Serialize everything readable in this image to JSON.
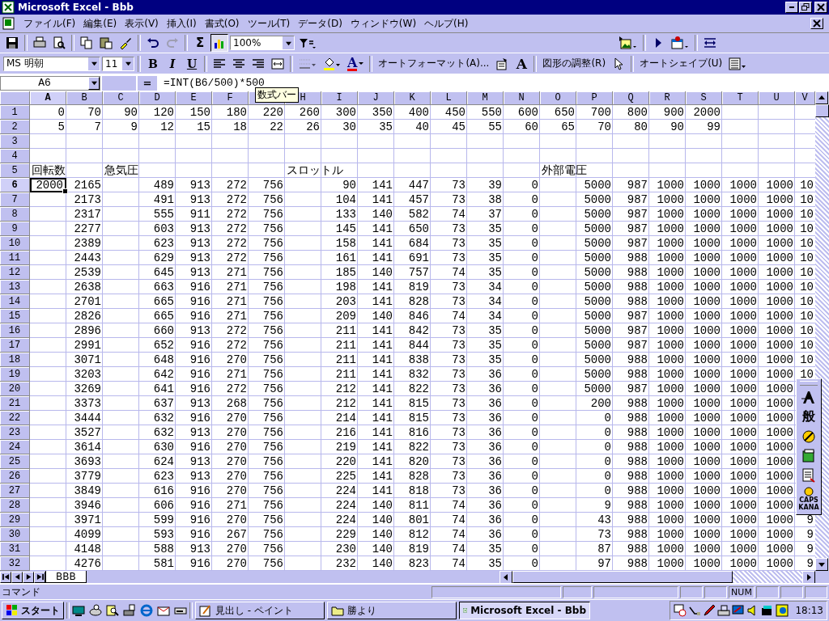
{
  "window": {
    "title": "Microsoft Excel - Bbb"
  },
  "menu": [
    "ファイル(F)",
    "編集(E)",
    "表示(V)",
    "挿入(I)",
    "書式(O)",
    "ツール(T)",
    "データ(D)",
    "ウィンドウ(W)",
    "ヘルプ(H)"
  ],
  "standard_toolbar": {
    "sum": "Σ",
    "zoom": "100%"
  },
  "format_toolbar": {
    "font": "MS 明朝",
    "size": "11",
    "bold": "B",
    "italic": "I",
    "underline": "U",
    "font_color": "A",
    "autoformat": "オートフォーマット(A)...",
    "font_size_letter": "A",
    "adjust_shapes": "図形の調整(R)",
    "autoshape": "オートシェイプ(U)"
  },
  "formula_bar": {
    "name_box": "A6",
    "equals": "=",
    "formula": "=INT(B6/500)*500",
    "tooltip": "数式バー"
  },
  "table": {
    "columns": [
      {
        "label": "A",
        "selected": true
      },
      {
        "label": "B",
        "selected": false
      },
      {
        "label": "C",
        "selected": false
      },
      {
        "label": "D",
        "selected": false
      },
      {
        "label": "E",
        "selected": false
      },
      {
        "label": "F",
        "selected": false
      },
      {
        "selected": false
      },
      {
        "label": "H",
        "selected": false
      },
      {
        "label": "I",
        "selected": false
      },
      {
        "label": "J",
        "selected": false
      },
      {
        "label": "K",
        "selected": false
      },
      {
        "label": "L",
        "selected": false
      },
      {
        "label": "M",
        "selected": false
      },
      {
        "label": "N",
        "selected": false
      },
      {
        "label": "O",
        "selected": false
      },
      {
        "label": "P",
        "selected": false
      },
      {
        "label": "Q",
        "selected": false
      },
      {
        "label": "R",
        "selected": false
      },
      {
        "label": "S",
        "selected": false
      },
      {
        "label": "T",
        "selected": false
      },
      {
        "label": "U",
        "selected": false
      },
      {
        "label": "V",
        "selected": false
      }
    ],
    "rows": [
      {
        "header": "1",
        "selected": false,
        "kind": "number",
        "cells": {
          "A": "0",
          "B": "70",
          "C": "90",
          "D": "120",
          "E": "150",
          "F": "180",
          "G": "220",
          "H": "260",
          "I": "300",
          "J": "350",
          "K": "400",
          "L": "450",
          "M": "550",
          "N": "600",
          "O": "650",
          "P": "700",
          "Q": "800",
          "R": "900",
          "S": "2000"
        }
      },
      {
        "header": "2",
        "selected": false,
        "kind": "number",
        "cells": {
          "A": "5",
          "B": "7",
          "C": "9",
          "D": "12",
          "E": "15",
          "F": "18",
          "G": "22",
          "H": "26",
          "I": "30",
          "J": "35",
          "K": "40",
          "L": "45",
          "M": "55",
          "N": "60",
          "O": "65",
          "P": "70",
          "Q": "80",
          "R": "90",
          "S": "99"
        }
      },
      {
        "header": "3",
        "selected": false,
        "cells": {}
      },
      {
        "header": "4",
        "selected": false,
        "cells": {}
      },
      {
        "header": "5",
        "selected": false,
        "kind": "heading",
        "cells": {
          "A": "回転数",
          "C": "急気圧",
          "H": "スロットル",
          "O": "外部電圧"
        }
      },
      {
        "header": "6",
        "selected": true,
        "kind": "number",
        "cells": {
          "A": "2000",
          "B": "2165",
          "D": "489",
          "E": "913",
          "F": "272",
          "G": "756",
          "I": "90",
          "J": "141",
          "K": "447",
          "L": "73",
          "M": "39",
          "N": "0",
          "P": "5000",
          "Q": "987",
          "R": "1000",
          "S": "1000",
          "T": "1000",
          "U": "1000",
          "V": "10"
        }
      },
      {
        "header": "7",
        "selected": false,
        "kind": "number",
        "cells": {
          "B": "2173",
          "D": "491",
          "E": "913",
          "F": "272",
          "G": "756",
          "I": "104",
          "J": "141",
          "K": "457",
          "L": "73",
          "M": "38",
          "N": "0",
          "P": "5000",
          "Q": "987",
          "R": "1000",
          "S": "1000",
          "T": "1000",
          "U": "1000",
          "V": "10"
        }
      },
      {
        "header": "8",
        "selected": false,
        "kind": "number",
        "cells": {
          "B": "2317",
          "D": "555",
          "E": "911",
          "F": "272",
          "G": "756",
          "I": "133",
          "J": "140",
          "K": "582",
          "L": "74",
          "M": "37",
          "N": "0",
          "P": "5000",
          "Q": "987",
          "R": "1000",
          "S": "1000",
          "T": "1000",
          "U": "1000",
          "V": "10"
        }
      },
      {
        "header": "9",
        "selected": false,
        "kind": "number",
        "cells": {
          "B": "2277",
          "D": "603",
          "E": "913",
          "F": "272",
          "G": "756",
          "I": "145",
          "J": "141",
          "K": "650",
          "L": "73",
          "M": "35",
          "N": "0",
          "P": "5000",
          "Q": "987",
          "R": "1000",
          "S": "1000",
          "T": "1000",
          "U": "1000",
          "V": "10"
        }
      },
      {
        "header": "10",
        "selected": false,
        "kind": "number",
        "cells": {
          "B": "2389",
          "D": "623",
          "E": "913",
          "F": "272",
          "G": "756",
          "I": "158",
          "J": "141",
          "K": "684",
          "L": "73",
          "M": "35",
          "N": "0",
          "P": "5000",
          "Q": "987",
          "R": "1000",
          "S": "1000",
          "T": "1000",
          "U": "1000",
          "V": "10"
        }
      },
      {
        "header": "11",
        "selected": false,
        "kind": "number",
        "cells": {
          "B": "2443",
          "D": "629",
          "E": "913",
          "F": "272",
          "G": "756",
          "I": "161",
          "J": "141",
          "K": "691",
          "L": "73",
          "M": "35",
          "N": "0",
          "P": "5000",
          "Q": "988",
          "R": "1000",
          "S": "1000",
          "T": "1000",
          "U": "1000",
          "V": "10"
        }
      },
      {
        "header": "12",
        "selected": false,
        "kind": "number",
        "cells": {
          "B": "2539",
          "D": "645",
          "E": "913",
          "F": "271",
          "G": "756",
          "I": "185",
          "J": "140",
          "K": "757",
          "L": "74",
          "M": "35",
          "N": "0",
          "P": "5000",
          "Q": "988",
          "R": "1000",
          "S": "1000",
          "T": "1000",
          "U": "1000",
          "V": "10"
        }
      },
      {
        "header": "13",
        "selected": false,
        "kind": "number",
        "cells": {
          "B": "2638",
          "D": "663",
          "E": "916",
          "F": "271",
          "G": "756",
          "I": "198",
          "J": "141",
          "K": "819",
          "L": "73",
          "M": "34",
          "N": "0",
          "P": "5000",
          "Q": "988",
          "R": "1000",
          "S": "1000",
          "T": "1000",
          "U": "1000",
          "V": "10"
        }
      },
      {
        "header": "14",
        "selected": false,
        "kind": "number",
        "cells": {
          "B": "2701",
          "D": "665",
          "E": "916",
          "F": "271",
          "G": "756",
          "I": "203",
          "J": "141",
          "K": "828",
          "L": "73",
          "M": "34",
          "N": "0",
          "P": "5000",
          "Q": "988",
          "R": "1000",
          "S": "1000",
          "T": "1000",
          "U": "1000",
          "V": "10"
        }
      },
      {
        "header": "15",
        "selected": false,
        "kind": "number",
        "cells": {
          "B": "2826",
          "D": "665",
          "E": "916",
          "F": "271",
          "G": "756",
          "I": "209",
          "J": "140",
          "K": "846",
          "L": "74",
          "M": "34",
          "N": "0",
          "P": "5000",
          "Q": "987",
          "R": "1000",
          "S": "1000",
          "T": "1000",
          "U": "1000",
          "V": "10"
        }
      },
      {
        "header": "16",
        "selected": false,
        "kind": "number",
        "cells": {
          "B": "2896",
          "D": "660",
          "E": "913",
          "F": "272",
          "G": "756",
          "I": "211",
          "J": "141",
          "K": "842",
          "L": "73",
          "M": "35",
          "N": "0",
          "P": "5000",
          "Q": "987",
          "R": "1000",
          "S": "1000",
          "T": "1000",
          "U": "1000",
          "V": "10"
        }
      },
      {
        "header": "17",
        "selected": false,
        "kind": "number",
        "cells": {
          "B": "2991",
          "D": "652",
          "E": "916",
          "F": "272",
          "G": "756",
          "I": "211",
          "J": "141",
          "K": "844",
          "L": "73",
          "M": "35",
          "N": "0",
          "P": "5000",
          "Q": "987",
          "R": "1000",
          "S": "1000",
          "T": "1000",
          "U": "1000",
          "V": "10"
        }
      },
      {
        "header": "18",
        "selected": false,
        "kind": "number",
        "cells": {
          "B": "3071",
          "D": "648",
          "E": "916",
          "F": "270",
          "G": "756",
          "I": "211",
          "J": "141",
          "K": "838",
          "L": "73",
          "M": "35",
          "N": "0",
          "P": "5000",
          "Q": "988",
          "R": "1000",
          "S": "1000",
          "T": "1000",
          "U": "1000",
          "V": "10"
        }
      },
      {
        "header": "19",
        "selected": false,
        "kind": "number",
        "cells": {
          "B": "3203",
          "D": "642",
          "E": "916",
          "F": "271",
          "G": "756",
          "I": "211",
          "J": "141",
          "K": "832",
          "L": "73",
          "M": "36",
          "N": "0",
          "P": "5000",
          "Q": "988",
          "R": "1000",
          "S": "1000",
          "T": "1000",
          "U": "1000",
          "V": "10"
        }
      },
      {
        "header": "20",
        "selected": false,
        "kind": "number",
        "cells": {
          "B": "3269",
          "D": "641",
          "E": "916",
          "F": "272",
          "G": "756",
          "I": "212",
          "J": "141",
          "K": "822",
          "L": "73",
          "M": "36",
          "N": "0",
          "P": "5000",
          "Q": "987",
          "R": "1000",
          "S": "1000",
          "T": "1000",
          "U": "1000"
        }
      },
      {
        "header": "21",
        "selected": false,
        "kind": "number",
        "cells": {
          "B": "3373",
          "D": "637",
          "E": "913",
          "F": "268",
          "G": "756",
          "I": "212",
          "J": "141",
          "K": "815",
          "L": "73",
          "M": "36",
          "N": "0",
          "P": "200",
          "Q": "988",
          "R": "1000",
          "S": "1000",
          "T": "1000",
          "U": "1000"
        }
      },
      {
        "header": "22",
        "selected": false,
        "kind": "number",
        "cells": {
          "B": "3444",
          "D": "632",
          "E": "916",
          "F": "270",
          "G": "756",
          "I": "214",
          "J": "141",
          "K": "815",
          "L": "73",
          "M": "36",
          "N": "0",
          "P": "0",
          "Q": "988",
          "R": "1000",
          "S": "1000",
          "T": "1000",
          "U": "1000"
        }
      },
      {
        "header": "23",
        "selected": false,
        "kind": "number",
        "cells": {
          "B": "3527",
          "D": "632",
          "E": "913",
          "F": "270",
          "G": "756",
          "I": "216",
          "J": "141",
          "K": "816",
          "L": "73",
          "M": "36",
          "N": "0",
          "P": "0",
          "Q": "988",
          "R": "1000",
          "S": "1000",
          "T": "1000",
          "U": "1000"
        }
      },
      {
        "header": "24",
        "selected": false,
        "kind": "number",
        "cells": {
          "B": "3614",
          "D": "630",
          "E": "916",
          "F": "270",
          "G": "756",
          "I": "219",
          "J": "141",
          "K": "822",
          "L": "73",
          "M": "36",
          "N": "0",
          "P": "0",
          "Q": "988",
          "R": "1000",
          "S": "1000",
          "T": "1000",
          "U": "1000"
        }
      },
      {
        "header": "25",
        "selected": false,
        "kind": "number",
        "cells": {
          "B": "3693",
          "D": "624",
          "E": "913",
          "F": "270",
          "G": "756",
          "I": "220",
          "J": "141",
          "K": "820",
          "L": "73",
          "M": "36",
          "N": "0",
          "P": "0",
          "Q": "988",
          "R": "1000",
          "S": "1000",
          "T": "1000",
          "U": "1000"
        }
      },
      {
        "header": "26",
        "selected": false,
        "kind": "number",
        "cells": {
          "B": "3779",
          "D": "623",
          "E": "913",
          "F": "270",
          "G": "756",
          "I": "225",
          "J": "141",
          "K": "828",
          "L": "73",
          "M": "36",
          "N": "0",
          "P": "0",
          "Q": "988",
          "R": "1000",
          "S": "1000",
          "T": "1000",
          "U": "1000"
        }
      },
      {
        "header": "27",
        "selected": false,
        "kind": "number",
        "cells": {
          "B": "3849",
          "D": "616",
          "E": "916",
          "F": "270",
          "G": "756",
          "I": "224",
          "J": "141",
          "K": "818",
          "L": "73",
          "M": "36",
          "N": "0",
          "P": "0",
          "Q": "988",
          "R": "1000",
          "S": "1000",
          "T": "1000",
          "U": "1000"
        }
      },
      {
        "header": "28",
        "selected": false,
        "kind": "number",
        "cells": {
          "B": "3946",
          "D": "606",
          "E": "916",
          "F": "271",
          "G": "756",
          "I": "224",
          "J": "140",
          "K": "811",
          "L": "74",
          "M": "36",
          "N": "0",
          "P": "9",
          "Q": "988",
          "R": "1000",
          "S": "1000",
          "T": "1000",
          "U": "1000"
        }
      },
      {
        "header": "29",
        "selected": false,
        "kind": "number",
        "cells": {
          "B": "3971",
          "D": "599",
          "E": "916",
          "F": "270",
          "G": "756",
          "I": "224",
          "J": "140",
          "K": "801",
          "L": "74",
          "M": "36",
          "N": "0",
          "P": "43",
          "Q": "988",
          "R": "1000",
          "S": "1000",
          "T": "1000",
          "U": "1000",
          "V": "9"
        }
      },
      {
        "header": "30",
        "selected": false,
        "kind": "number",
        "cells": {
          "B": "4099",
          "D": "593",
          "E": "916",
          "F": "267",
          "G": "756",
          "I": "229",
          "J": "140",
          "K": "812",
          "L": "74",
          "M": "36",
          "N": "0",
          "P": "73",
          "Q": "988",
          "R": "1000",
          "S": "1000",
          "T": "1000",
          "U": "1000",
          "V": "9"
        }
      },
      {
        "header": "31",
        "selected": false,
        "kind": "number",
        "cells": {
          "B": "4148",
          "D": "588",
          "E": "913",
          "F": "270",
          "G": "756",
          "I": "230",
          "J": "140",
          "K": "819",
          "L": "74",
          "M": "35",
          "N": "0",
          "P": "87",
          "Q": "988",
          "R": "1000",
          "S": "1000",
          "T": "1000",
          "U": "1000",
          "V": "9"
        }
      },
      {
        "header": "32",
        "selected": false,
        "kind": "number",
        "cells": {
          "B": "4276",
          "D": "581",
          "E": "916",
          "F": "270",
          "G": "756",
          "I": "232",
          "J": "140",
          "K": "823",
          "L": "74",
          "M": "35",
          "N": "0",
          "P": "97",
          "Q": "988",
          "R": "1000",
          "S": "1000",
          "T": "1000",
          "U": "1000",
          "V": "9"
        }
      }
    ]
  },
  "ime_toolbar": {
    "mode": "般",
    "caps": "CAPS",
    "kana": "KANA"
  },
  "sheet_tabs": [
    {
      "label": "BBB",
      "selected": true
    }
  ],
  "status_bar": {
    "mode": "コマンド",
    "indicator": "NUM"
  },
  "taskbar": {
    "start": "スタート",
    "tasks": [
      {
        "label": "見出し - ペイント",
        "kind": "paint",
        "selected": false
      },
      {
        "label": "勝より",
        "kind": "folder",
        "selected": false
      },
      {
        "label": "Microsoft Excel - Bbb",
        "kind": "excel",
        "selected": true
      }
    ],
    "clock": "18:13"
  }
}
